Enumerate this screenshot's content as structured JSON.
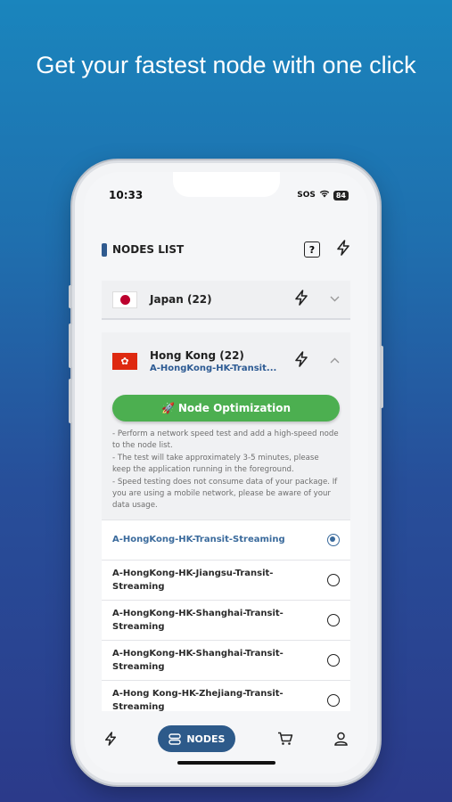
{
  "headline": "Get your fastest node with one click",
  "status_bar": {
    "time": "10:33",
    "sos": "SOS",
    "battery": "84"
  },
  "header": {
    "title": "NODES LIST",
    "help_icon": "question-box-icon",
    "fast_icon": "lightning-icon"
  },
  "countries": [
    {
      "name": "Japan (22)",
      "flag": "japan-flag-icon",
      "expanded": false
    },
    {
      "name": "Hong Kong (22)",
      "flag": "hong-kong-flag-icon",
      "expanded": true,
      "selected_node": "A-HongKong-HK-Transit..."
    }
  ],
  "optimization": {
    "button_label": "Node Optimization",
    "notes": [
      "- Perform a network speed test and add a high-speed node to the node list.",
      "- The test will take approximately 3-5 minutes, please keep the application running in the foreground.",
      "- Speed testing does not consume data of your package. If you are using a mobile network, please be aware of your data usage."
    ]
  },
  "nodes": [
    {
      "label": "A-HongKong-HK-Transit-Streaming",
      "selected": true
    },
    {
      "label": "A-HongKong-HK-Jiangsu-Transit-Streaming",
      "selected": false
    },
    {
      "label": "A-HongKong-HK-Shanghai-Transit-Streaming",
      "selected": false
    },
    {
      "label": "A-HongKong-HK-Shanghai-Transit-Streaming",
      "selected": false
    },
    {
      "label": "A-Hong Kong-HK-Zhejiang-Transit-Streaming",
      "selected": false
    }
  ],
  "tabbar": {
    "active_label": "NODES"
  }
}
